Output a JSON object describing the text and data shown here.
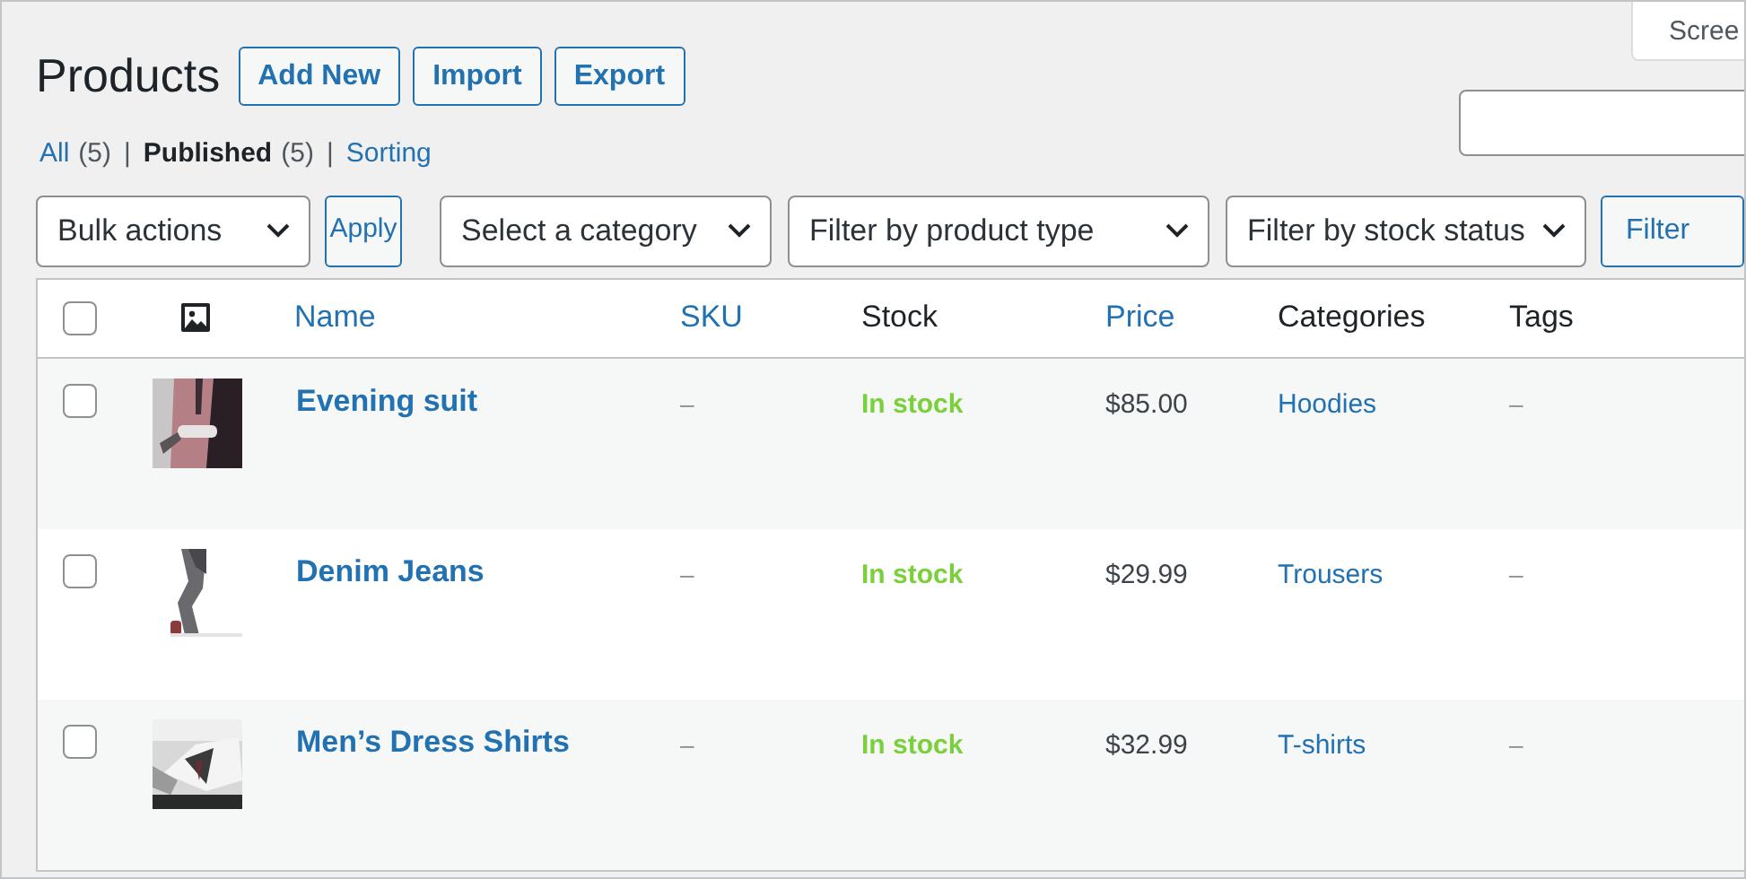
{
  "screen_options": {
    "label": "Scree"
  },
  "title": "Products",
  "header_buttons": [
    "Add New",
    "Import",
    "Export"
  ],
  "views": [
    {
      "label": "All",
      "count": "(5)",
      "selected": false
    },
    {
      "separator": "|",
      "label": "Published",
      "count": "(5)",
      "selected": true
    },
    {
      "separator": "|",
      "label": "Sorting",
      "selected": false
    }
  ],
  "bulk_actions": {
    "value": "Bulk actions",
    "button": "Apply"
  },
  "filters": [
    "Select a category",
    "Filter by product type",
    "Filter by stock status"
  ],
  "filter_button": "Filter",
  "table": {
    "select_all": {
      "checked": false
    },
    "columns": [
      {
        "label": "Name",
        "sortable": true
      },
      {
        "label": "SKU",
        "sortable": true
      },
      {
        "label": "Stock",
        "sortable": false
      },
      {
        "label": "Price",
        "sortable": true
      },
      {
        "label": "Categories",
        "sortable": false
      },
      {
        "label": "Tags",
        "sortable": false
      }
    ],
    "rows": [
      {
        "checked": false,
        "kind": "picture",
        "name": "Evening suit",
        "sku": "–",
        "stock": "In stock",
        "price": "$85.00",
        "category": "Hoodies",
        "tags": "–"
      },
      {
        "checked": false,
        "kind": "picture",
        "name": "Denim Jeans",
        "sku": "–",
        "stock": "In stock",
        "price": "$29.99",
        "category": "Trousers",
        "tags": "–"
      },
      {
        "checked": false,
        "kind": "picture",
        "name": "Men’s Dress Shirts",
        "sku": "–",
        "stock": "In stock",
        "price": "$32.99",
        "category": "T-shirts",
        "tags": "–"
      }
    ]
  }
}
